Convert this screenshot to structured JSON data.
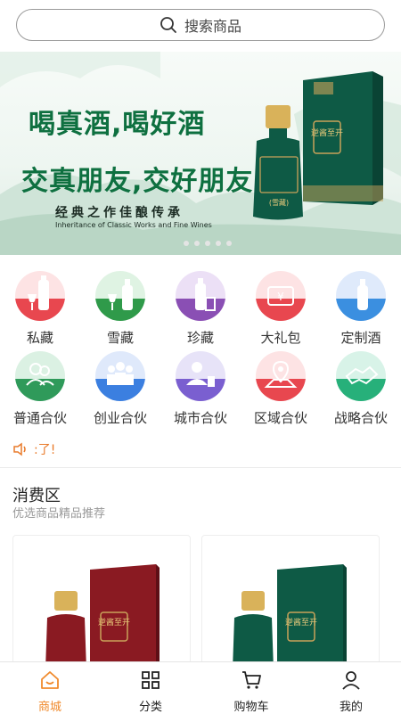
{
  "search": {
    "placeholder": "搜索商品",
    "icon": "search-icon"
  },
  "banner": {
    "headline1": "喝真酒,喝好酒",
    "headline2": "交真朋友,交好朋友",
    "tagline": "经典之作佳酿传承",
    "tagline_en": "Inheritance of Classic Works and Fine Wines",
    "box_label": "逆酱至开",
    "bottle_label": "(雪藏)",
    "brand_color": "#0e5a45"
  },
  "categories": [
    {
      "label": "私藏",
      "color": "#e8474f",
      "icon": "wine-glass-icon"
    },
    {
      "label": "雪藏",
      "color": "#2f9a4a",
      "icon": "wine-bottle-icon"
    },
    {
      "label": "珍藏",
      "color": "#8a4fb4",
      "icon": "bottle-box-icon"
    },
    {
      "label": "大礼包",
      "color": "#e8474f",
      "icon": "gift-coupon-icon"
    },
    {
      "label": "定制酒",
      "color": "#3b8fe0",
      "icon": "custom-bottle-icon"
    },
    {
      "label": "普通合伙",
      "color": "#2f9a5a",
      "icon": "partners-icon"
    },
    {
      "label": "创业合伙",
      "color": "#3b7fe0",
      "icon": "team-icon"
    },
    {
      "label": "城市合伙",
      "color": "#7a5fd0",
      "icon": "city-person-icon"
    },
    {
      "label": "区域合伙",
      "color": "#e8474f",
      "icon": "map-pin-icon"
    },
    {
      "label": "战略合伙",
      "color": "#27b07a",
      "icon": "handshake-icon"
    }
  ],
  "notice": {
    "text": ":了!",
    "color": "#e97a2a"
  },
  "section": {
    "title": "消费区",
    "subtitle": "优选商品精品推荐"
  },
  "products": [
    {
      "box_color": "#8a1a22",
      "label": "逆酱至开"
    },
    {
      "box_color": "#0e5a45",
      "label": "逆酱至开"
    }
  ],
  "tabs": [
    {
      "label": "商城",
      "icon": "home-icon",
      "active": true
    },
    {
      "label": "分类",
      "icon": "grid-icon",
      "active": false
    },
    {
      "label": "购物车",
      "icon": "cart-icon",
      "active": false
    },
    {
      "label": "我的",
      "icon": "user-icon",
      "active": false
    }
  ],
  "accent": "#f08a2c"
}
